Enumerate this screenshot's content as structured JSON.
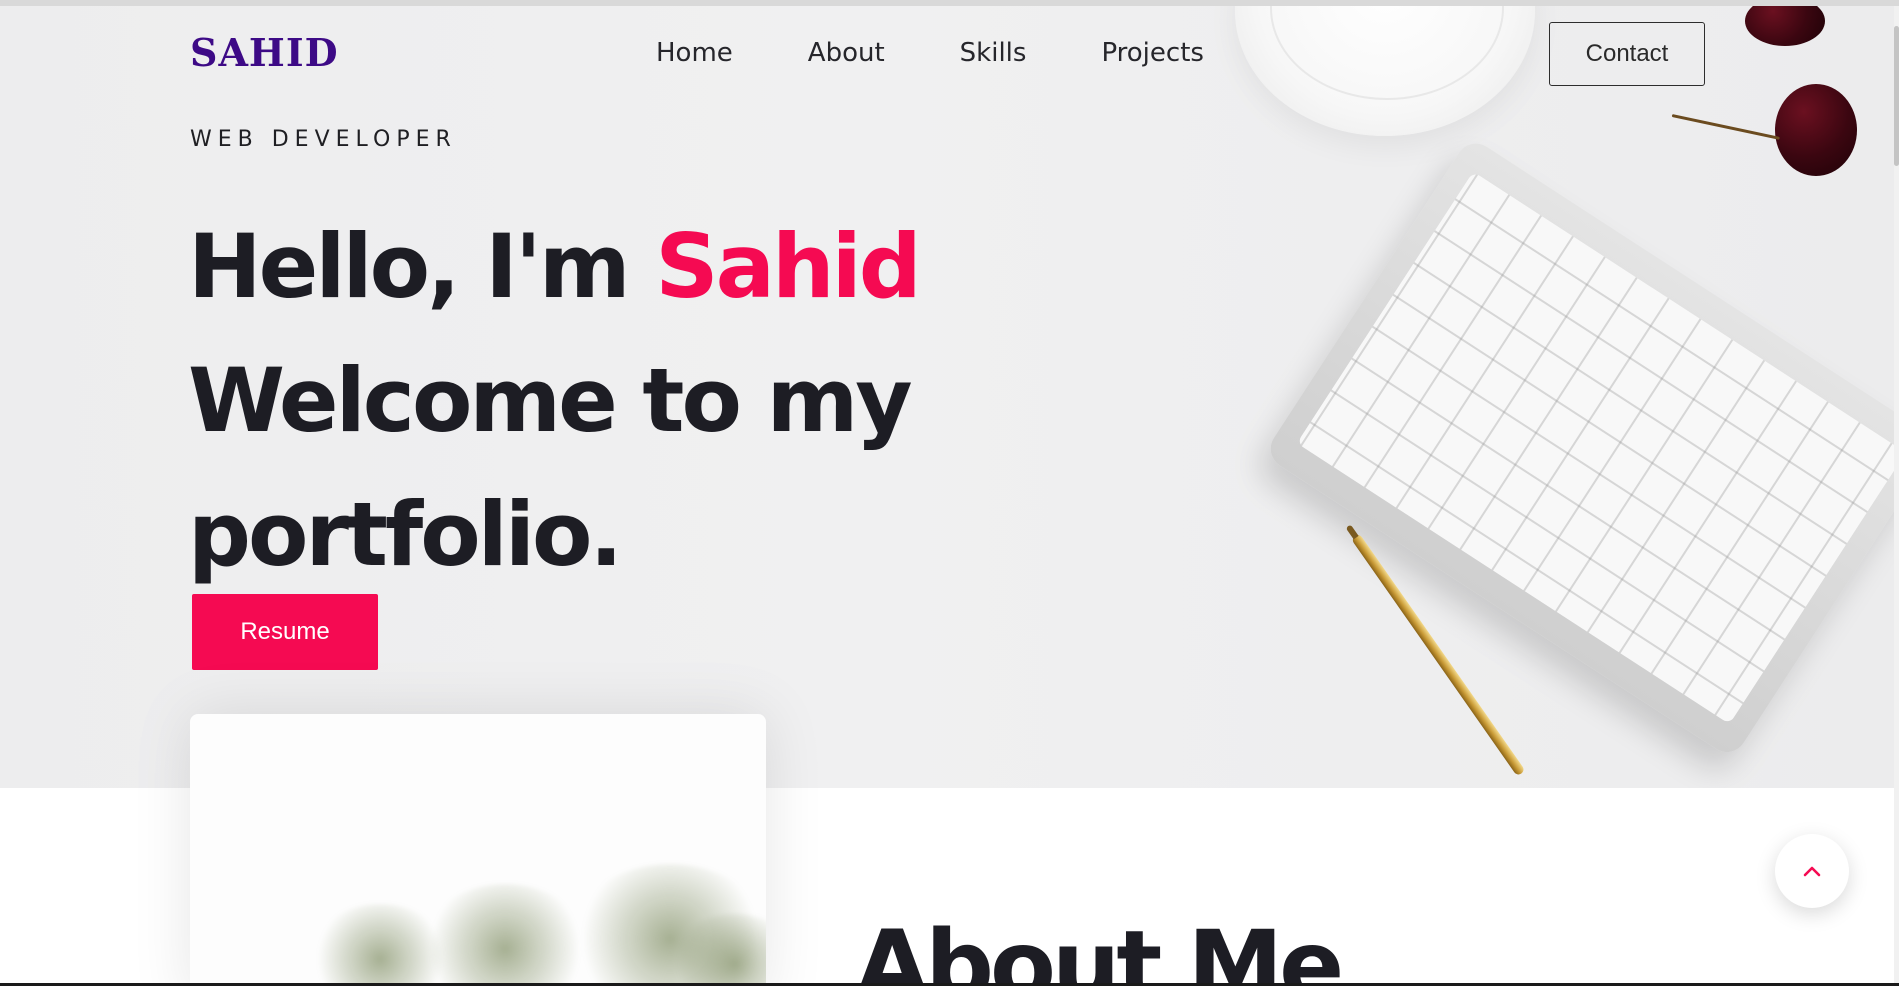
{
  "brand": {
    "logo": "SAHID",
    "logo_color": "#3d0a86",
    "accent_color": "#f50a52"
  },
  "nav": {
    "items": [
      {
        "label": "Home"
      },
      {
        "label": "About"
      },
      {
        "label": "Skills"
      },
      {
        "label": "Projects"
      }
    ],
    "contact_label": "Contact"
  },
  "hero": {
    "subtitle": "WEB DEVELOPER",
    "greeting": "Hello, I'm ",
    "name": "Sahid",
    "line2": "Welcome to my",
    "line3": "portfolio.",
    "resume_label": "Resume"
  },
  "about": {
    "title": "About Me"
  },
  "icons": {
    "back_to_top": "chevron-up-icon"
  }
}
